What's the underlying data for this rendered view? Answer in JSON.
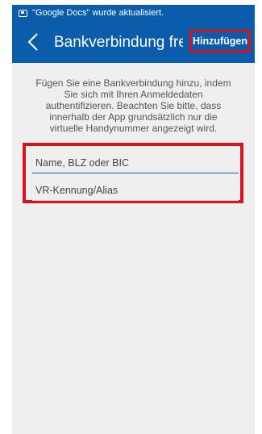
{
  "status_bar": {
    "notification_icon": "notification-icon",
    "text": "\"Google Docs\" wurde aktualisiert."
  },
  "app_bar": {
    "back_icon": "chevron-left-icon",
    "title": "Bankverbindung frei...",
    "action_label": "Hinzufügen"
  },
  "main": {
    "description": "Fügen Sie eine Bankverbindung hinzu, indem\nSie sich mit Ihren Anmeldedaten\nauthentifizieren. Beachten Sie bitte, dass\ninnerhalb der App grundsätzlich nur die\nvirtuelle Handynummer angezeigt wird.",
    "fields": [
      {
        "placeholder": "Name, BLZ oder BIC",
        "value": ""
      },
      {
        "placeholder": "VR-Kennung/Alias",
        "value": ""
      }
    ]
  },
  "colors": {
    "brand_blue": "#0b5cab",
    "highlight_red": "#d8131b",
    "background": "#efeff0"
  }
}
